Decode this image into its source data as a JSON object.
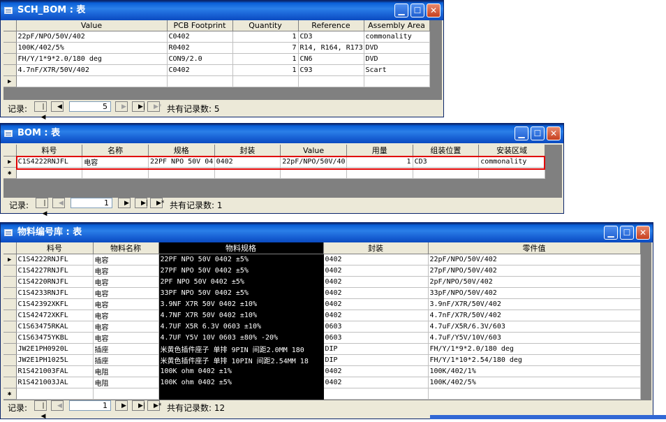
{
  "win1": {
    "title": "SCH_BOM : 表",
    "columns": [
      "Value",
      "PCB Footprint",
      "Quantity",
      "Reference",
      "Assembly Area"
    ],
    "rows": [
      {
        "value": "22pF/NPO/50V/402",
        "footprint": "C0402",
        "quantity": "1",
        "reference": "CD3",
        "area": "commonality"
      },
      {
        "value": "100K/402/5%",
        "footprint": "R0402",
        "quantity": "7",
        "reference": "R14, R164, R173, R",
        "area": "DVD"
      },
      {
        "value": "FH/Y/1*9*2.0/180 deg",
        "footprint": "CON9/2.0",
        "quantity": "1",
        "reference": "CN6",
        "area": "DVD"
      },
      {
        "value": "4.7nF/X7R/50V/402",
        "footprint": "C0402",
        "quantity": "1",
        "reference": "C93",
        "area": "Scart"
      }
    ],
    "nav": {
      "label": "记录:",
      "current": "5",
      "total_label": "共有记录数: 5"
    }
  },
  "win2": {
    "title": "BOM : 表",
    "columns": [
      "料号",
      "名称",
      "规格",
      "封装",
      "Value",
      "用量",
      "组装位置",
      "安装区域"
    ],
    "rows": [
      {
        "code": "C1S4222RNJFL",
        "name": "电容",
        "spec": "22PF NPO 50V 04",
        "pkg": "0402",
        "value": "22pF/NPO/50V/40",
        "qty": "1",
        "pos": "CD3",
        "area": "commonality"
      }
    ],
    "nav": {
      "label": "记录:",
      "current": "1",
      "total_label": "共有记录数: 1"
    }
  },
  "win3": {
    "title": "物料编号库 : 表",
    "columns": [
      "料号",
      "物料名称",
      "物料规格",
      "封装",
      "零件值"
    ],
    "rows": [
      {
        "code": "C1S4222RNJFL",
        "name": "电容",
        "spec": "22PF NPO 50V 0402 ±5%",
        "pkg": "0402",
        "val": "22pF/NPO/50V/402"
      },
      {
        "code": "C1S4227RNJFL",
        "name": "电容",
        "spec": "27PF NPO 50V 0402 ±5%",
        "pkg": "0402",
        "val": "27pF/NPO/50V/402"
      },
      {
        "code": "C1S4220RNJFL",
        "name": "电容",
        "spec": "2PF NPO 50V 0402 ±5%",
        "pkg": "0402",
        "val": "2pF/NPO/50V/402"
      },
      {
        "code": "C1S4233RNJFL",
        "name": "电容",
        "spec": "33PF NPO 50V 0402 ±5%",
        "pkg": "0402",
        "val": "33pF/NPO/50V/402"
      },
      {
        "code": "C1S42392XKFL",
        "name": "电容",
        "spec": "3.9NF X7R 50V 0402 ±10%",
        "pkg": "0402",
        "val": "3.9nF/X7R/50V/402"
      },
      {
        "code": "C1S42472XKFL",
        "name": "电容",
        "spec": "4.7NF X7R 50V 0402 ±10%",
        "pkg": "0402",
        "val": "4.7nF/X7R/50V/402"
      },
      {
        "code": "C1S63475RKAL",
        "name": "电容",
        "spec": "4.7UF X5R 6.3V 0603 ±10%",
        "pkg": "0603",
        "val": "4.7uF/X5R/6.3V/603"
      },
      {
        "code": "C1S63475YKBL",
        "name": "电容",
        "spec": "4.7UF Y5V 10V 0603 ±80% -20%",
        "pkg": "0603",
        "val": "4.7uF/Y5V/10V/603"
      },
      {
        "code": "JW2E1PH0920L",
        "name": "插座",
        "spec": "米黄色插件座子 单排 9PIN 间距2.0MM  180",
        "pkg": "DIP",
        "val": "FH/Y/1*9*2.0/180 deg"
      },
      {
        "code": "JW2E1PH1025L",
        "name": "插座",
        "spec": "米黄色插件座子 单排 10PIN 间距2.54MM 18",
        "pkg": "DIP",
        "val": "FH/Y/1*10*2.54/180 deg"
      },
      {
        "code": "R1S421003FAL",
        "name": "电阻",
        "spec": "100K ohm 0402 ±1%",
        "pkg": "0402",
        "val": "100K/402/1%"
      },
      {
        "code": "R1S421003JAL",
        "name": "电阻",
        "spec": "100K ohm 0402 ±5%",
        "pkg": "0402",
        "val": "100K/402/5%"
      }
    ],
    "nav": {
      "label": "记录:",
      "current": "1",
      "total_label": "共有记录数: 12"
    }
  },
  "icons": {
    "minimize": "minimize-icon",
    "maximize": "maximize-icon",
    "close": "close-icon",
    "first": "first-record-icon",
    "prev": "previous-record-icon",
    "next": "next-record-icon",
    "last": "last-record-icon",
    "new": "new-record-icon",
    "current_row": "current-row-pointer-icon",
    "new_row": "new-row-star-icon"
  },
  "colors": {
    "title_bar": "#1a63d6",
    "highlight_box": "#e00000",
    "selected_column": "#000000",
    "workspace": "#808080"
  }
}
